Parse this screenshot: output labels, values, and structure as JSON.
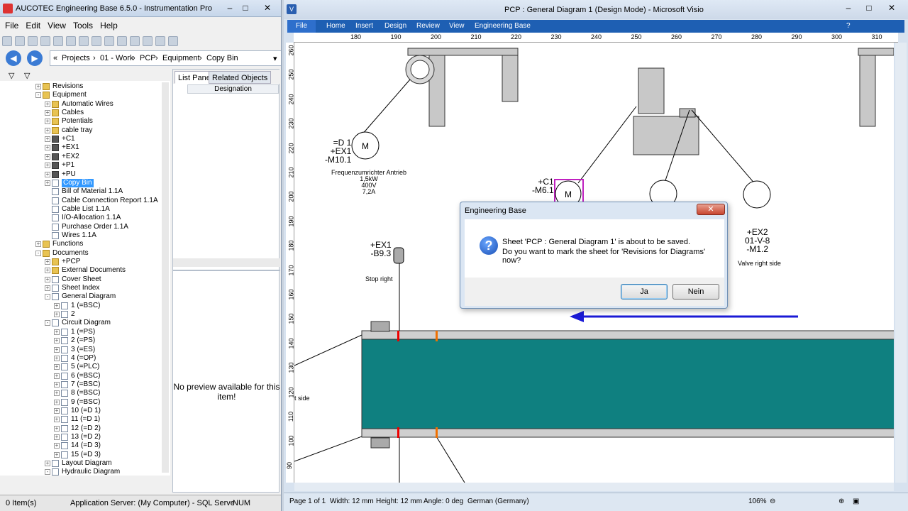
{
  "eb": {
    "title": "AUCOTEC     Engineering Base 6.5.0 - Instrumentation Pro",
    "menu": [
      "File",
      "Edit",
      "View",
      "Tools",
      "Help"
    ],
    "breadcrumb": [
      "Projects",
      "01 - Work",
      "PCP",
      "Equipment",
      "Copy Bin"
    ],
    "tree": [
      {
        "label": "Revisions",
        "depth": 1,
        "exp": "+",
        "icon": "fold"
      },
      {
        "label": "Equipment",
        "depth": 1,
        "exp": "-",
        "icon": "fold"
      },
      {
        "label": "Automatic Wires",
        "depth": 2,
        "exp": "+",
        "icon": "fold"
      },
      {
        "label": "Cables",
        "depth": 2,
        "exp": "+",
        "icon": "fold"
      },
      {
        "label": "Potentials",
        "depth": 2,
        "exp": "+",
        "icon": "fold"
      },
      {
        "label": "cable tray",
        "depth": 2,
        "exp": "+",
        "icon": "fold"
      },
      {
        "label": "+C1",
        "depth": 2,
        "exp": "+",
        "icon": "eq"
      },
      {
        "label": "+EX1",
        "depth": 2,
        "exp": "+",
        "icon": "eq"
      },
      {
        "label": "+EX2",
        "depth": 2,
        "exp": "+",
        "icon": "eq"
      },
      {
        "label": "+P1",
        "depth": 2,
        "exp": "+",
        "icon": "eq"
      },
      {
        "label": "+PU",
        "depth": 2,
        "exp": "+",
        "icon": "eq"
      },
      {
        "label": "Copy Bin",
        "depth": 2,
        "exp": "+",
        "icon": "doc",
        "selected": true
      },
      {
        "label": "Bill of Material 1.1A",
        "depth": 2,
        "exp": "",
        "icon": "doc"
      },
      {
        "label": "Cable Connection Report 1.1A",
        "depth": 2,
        "exp": "",
        "icon": "doc"
      },
      {
        "label": "Cable List 1.1A",
        "depth": 2,
        "exp": "",
        "icon": "doc"
      },
      {
        "label": "I/O-Allocation 1.1A",
        "depth": 2,
        "exp": "",
        "icon": "doc"
      },
      {
        "label": "Purchase Order 1.1A",
        "depth": 2,
        "exp": "",
        "icon": "doc"
      },
      {
        "label": "Wires 1.1A",
        "depth": 2,
        "exp": "",
        "icon": "doc"
      },
      {
        "label": "Functions",
        "depth": 1,
        "exp": "+",
        "icon": "fold"
      },
      {
        "label": "Documents",
        "depth": 1,
        "exp": "-",
        "icon": "fold"
      },
      {
        "label": "+PCP",
        "depth": 2,
        "exp": "+",
        "icon": "fold"
      },
      {
        "label": "External Documents",
        "depth": 2,
        "exp": "+",
        "icon": "fold"
      },
      {
        "label": "Cover Sheet",
        "depth": 2,
        "exp": "+",
        "icon": "doc"
      },
      {
        "label": "Sheet Index",
        "depth": 2,
        "exp": "+",
        "icon": "doc"
      },
      {
        "label": "General Diagram",
        "depth": 2,
        "exp": "-",
        "icon": "doc"
      },
      {
        "label": "1 (=BSC)",
        "depth": 3,
        "exp": "+",
        "icon": "doc"
      },
      {
        "label": "2",
        "depth": 3,
        "exp": "+",
        "icon": "doc"
      },
      {
        "label": "Circuit Diagram",
        "depth": 2,
        "exp": "-",
        "icon": "doc"
      },
      {
        "label": "1 (=PS)",
        "depth": 3,
        "exp": "+",
        "icon": "doc"
      },
      {
        "label": "2 (=PS)",
        "depth": 3,
        "exp": "+",
        "icon": "doc"
      },
      {
        "label": "3 (=ES)",
        "depth": 3,
        "exp": "+",
        "icon": "doc"
      },
      {
        "label": "4 (=OP)",
        "depth": 3,
        "exp": "+",
        "icon": "doc"
      },
      {
        "label": "5 (=PLC)",
        "depth": 3,
        "exp": "+",
        "icon": "doc"
      },
      {
        "label": "6 (=BSC)",
        "depth": 3,
        "exp": "+",
        "icon": "doc"
      },
      {
        "label": "7 (=BSC)",
        "depth": 3,
        "exp": "+",
        "icon": "doc"
      },
      {
        "label": "8 (=BSC)",
        "depth": 3,
        "exp": "+",
        "icon": "doc"
      },
      {
        "label": "9 (=BSC)",
        "depth": 3,
        "exp": "+",
        "icon": "doc"
      },
      {
        "label": "10 (=D 1)",
        "depth": 3,
        "exp": "+",
        "icon": "doc"
      },
      {
        "label": "11 (=D 1)",
        "depth": 3,
        "exp": "+",
        "icon": "doc"
      },
      {
        "label": "12 (=D 2)",
        "depth": 3,
        "exp": "+",
        "icon": "doc"
      },
      {
        "label": "13 (=D 2)",
        "depth": 3,
        "exp": "+",
        "icon": "doc"
      },
      {
        "label": "14 (=D 3)",
        "depth": 3,
        "exp": "+",
        "icon": "doc"
      },
      {
        "label": "15 (=D 3)",
        "depth": 3,
        "exp": "+",
        "icon": "doc"
      },
      {
        "label": "Layout Diagram",
        "depth": 2,
        "exp": "+",
        "icon": "doc"
      },
      {
        "label": "Hydraulic Diagram",
        "depth": 2,
        "exp": "-",
        "icon": "doc"
      }
    ],
    "tab_list": "List Pane",
    "tab_related": "Related Objects",
    "col_designation": "Designation",
    "preview_text": "No preview available for this item!",
    "status_items": "0 Item(s)",
    "status_server": "Application Server: (My Computer) - SQL Serve",
    "status_num": "NUM"
  },
  "visio": {
    "title": "PCP : General Diagram 1 (Design Mode) - Microsoft Visio",
    "ribbon": [
      "File",
      "Home",
      "Insert",
      "Design",
      "Review",
      "View",
      "Engineering Base"
    ],
    "ruler_h": [
      "180",
      "190",
      "200",
      "210",
      "220",
      "230",
      "240",
      "250",
      "260",
      "270",
      "280",
      "290",
      "300",
      "310"
    ],
    "ruler_v": [
      "260",
      "250",
      "240",
      "230",
      "220",
      "210",
      "200",
      "190",
      "180",
      "170",
      "160",
      "150",
      "140",
      "130",
      "120",
      "110",
      "100",
      "90"
    ],
    "status": {
      "page": "Page 1 of 1",
      "width": "Width: 12 mm",
      "height": "Height: 12 mm",
      "angle": "Angle: 0 deg",
      "lang": "German (Germany)",
      "zoom": "106%"
    },
    "diagram": {
      "d1_tag": [
        "=D 1",
        "+EX1",
        "-M10.1"
      ],
      "d1_note": [
        "Frequenzumrichter Antrieb",
        "1,5kW",
        "400V",
        "7,2A"
      ],
      "c1_tag": [
        "+C1",
        "-M6.1"
      ],
      "ex1_tag": [
        "+EX1",
        "-B9.3"
      ],
      "stop_right": "Stop right",
      "ex2_tag": [
        "+EX2",
        "01-V-8",
        "-M1.2"
      ],
      "valve_right": "Valve right side",
      "t_side": "t side",
      "m": "M"
    }
  },
  "dialog": {
    "title": "Engineering Base",
    "line1": "Sheet 'PCP : General Diagram 1' is about to be saved.",
    "line2": "Do you want to mark the sheet for 'Revisions for Diagrams' now?",
    "yes": "Ja",
    "no": "Nein"
  }
}
